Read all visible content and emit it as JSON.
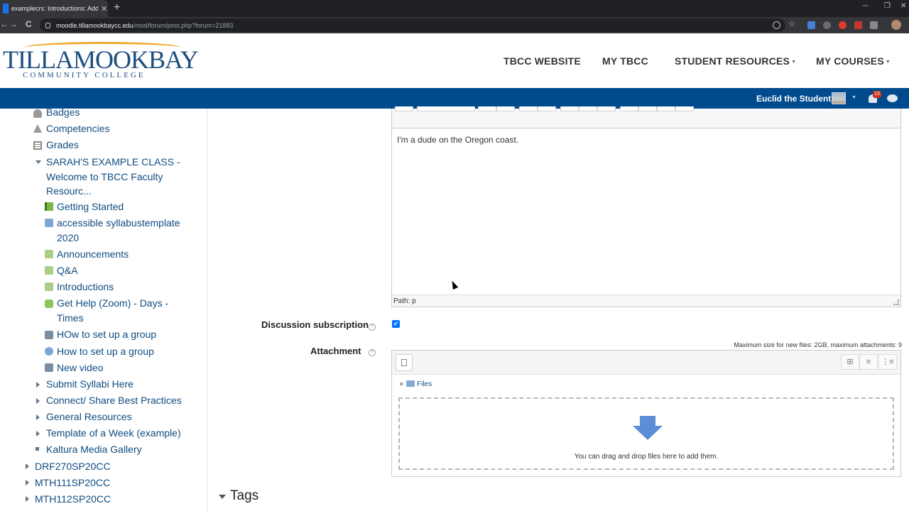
{
  "browser": {
    "tab_title": "examplecrs: Introductions: Add a",
    "tab_close": "✕",
    "new_tab": "+",
    "url_host": "moodle.tillamookbaycc.edu",
    "url_path": "/mod/forum/post.php?forum=21883",
    "back": "←",
    "forward": "→",
    "reload": "C",
    "minimize": "─",
    "restore": "❐",
    "close": "✕"
  },
  "header": {
    "logo_main": "TILLAMOOKBAY",
    "logo_sub": "COMMUNITY COLLEGE",
    "nav": [
      {
        "label": "TBCC WEBSITE"
      },
      {
        "label": "MY TBCC"
      },
      {
        "label": "STUDENT RESOURCES"
      },
      {
        "label": "MY COURSES"
      }
    ],
    "caret": "▼"
  },
  "navbar": {
    "user_name": "Euclid the Student",
    "notification_count": "13",
    "caret": "▼"
  },
  "drawer": {
    "items": [
      {
        "label": "Badges"
      },
      {
        "label": "Competencies"
      },
      {
        "label": "Grades"
      },
      {
        "label": "SARAH'S EXAMPLE CLASS - Welcome to TBCC Faculty Resourc..."
      },
      {
        "label": "Getting Started"
      },
      {
        "label": "accessible syllabustemplate 2020"
      },
      {
        "label": "Announcements"
      },
      {
        "label": "Q&A"
      },
      {
        "label": "Introductions"
      },
      {
        "label": "Get Help (Zoom) - Days - Times"
      },
      {
        "label": "HOw to set up a group"
      },
      {
        "label": "How to set up a group"
      },
      {
        "label": "New video"
      },
      {
        "label": "Submit Syllabi Here"
      },
      {
        "label": "Connect/ Share Best Practices"
      },
      {
        "label": "General Resources"
      },
      {
        "label": "Template of a Week (example)"
      },
      {
        "label": "Kaltura Media Gallery"
      },
      {
        "label": "DRF270SP20CC"
      },
      {
        "label": "MTH111SP20CC"
      },
      {
        "label": "MTH112SP20CC"
      }
    ]
  },
  "form": {
    "message_text": "I'm a dude on the Oregon coast.",
    "path_label": "Path: p",
    "subscription_label": "Discussion subscription",
    "subscription_checked": "✔",
    "attachment_label": "Attachment",
    "help_glyph": "?",
    "max_size": "Maximum size for new files: 2GB, maximum attachments: 9",
    "files_label": "Files",
    "drop_text": "You can drag and drop files here to add them.",
    "view_icons": [
      "⊞",
      "≡",
      "⋮≡"
    ],
    "tags_label": "Tags"
  }
}
